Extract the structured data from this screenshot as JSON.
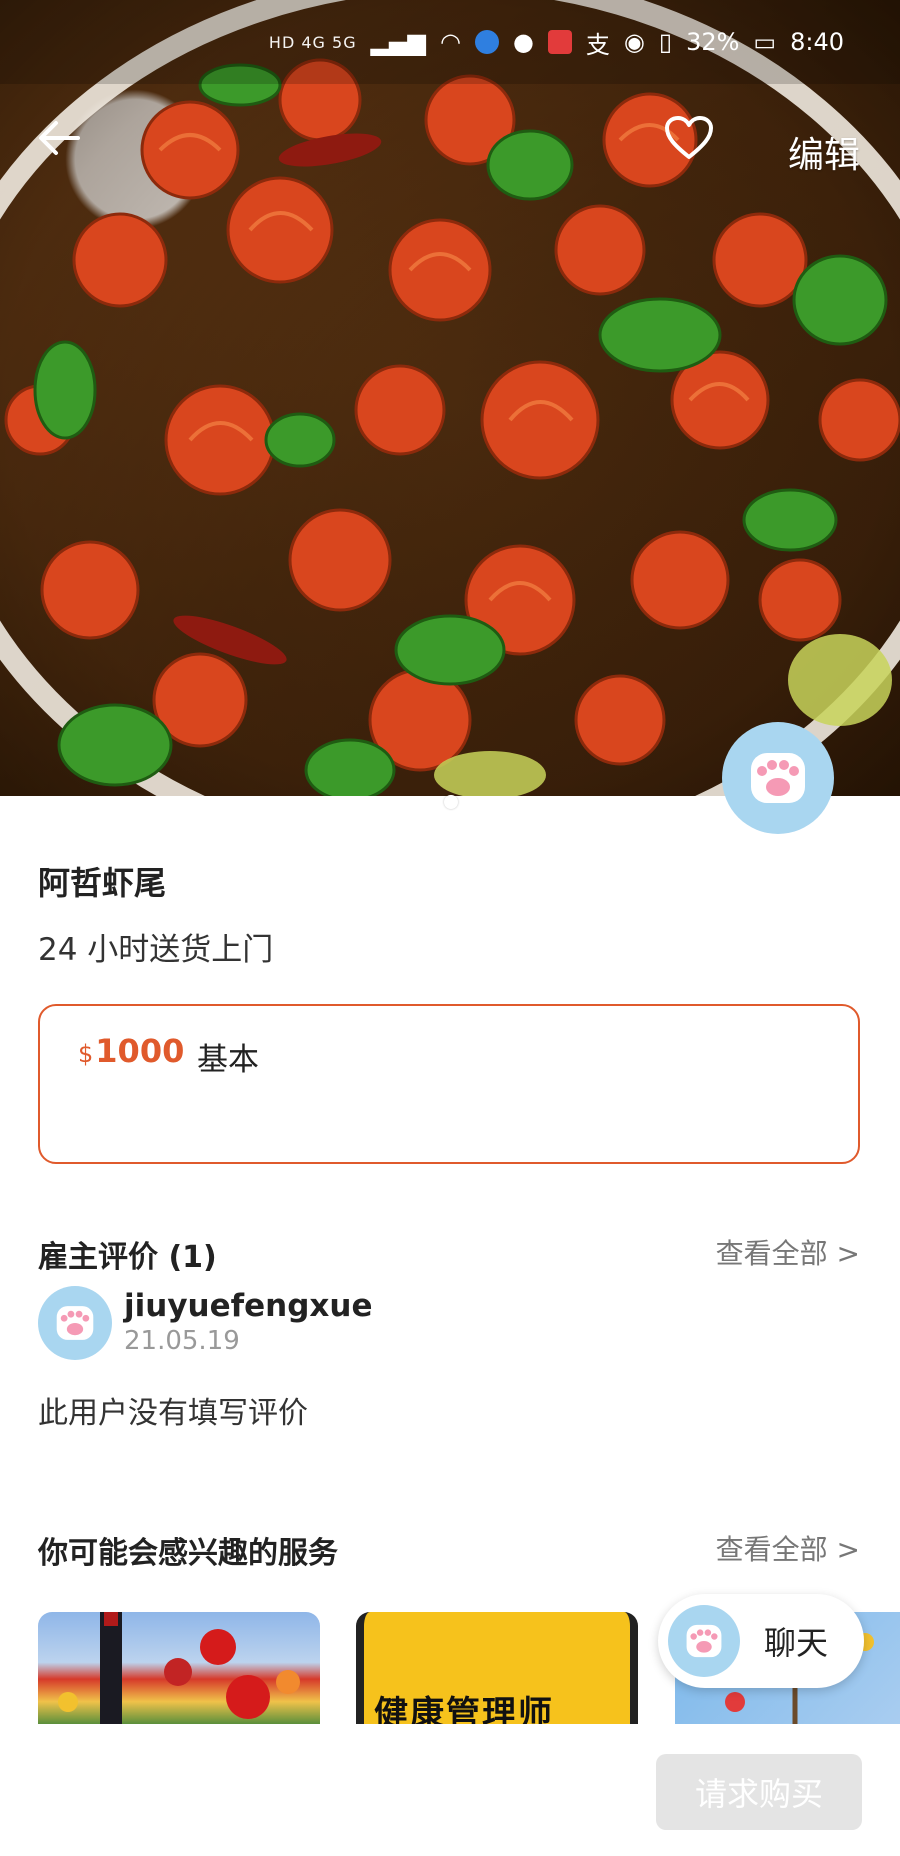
{
  "status_bar": {
    "network_labels": "HD 4G 5G",
    "battery": "32%",
    "time": "8:40"
  },
  "nav": {
    "edit_label": "编辑"
  },
  "listing": {
    "title": "阿哲虾尾",
    "subtitle": "24 小时送货上门",
    "price_currency": "$",
    "price_amount": "1000",
    "price_tier": "基本"
  },
  "reviews": {
    "heading": "雇主评价 (1)",
    "view_all": "查看全部 >",
    "items": [
      {
        "user": "jiuyuefengxue",
        "date": "21.05.19",
        "text": "此用户没有填写评价"
      }
    ]
  },
  "recommendations": {
    "heading": "你可能会感兴趣的服务",
    "view_all": "查看全部 >",
    "cards": [
      {
        "text": ""
      },
      {
        "text": "健康管理师"
      },
      {
        "text": ""
      }
    ]
  },
  "chat": {
    "label": "聊天"
  },
  "actions": {
    "buy_label": "请求购买"
  },
  "colors": {
    "accent": "#e05a2c",
    "avatar_bg": "#a9d6f0",
    "disabled_button": "#e4e4e4"
  }
}
